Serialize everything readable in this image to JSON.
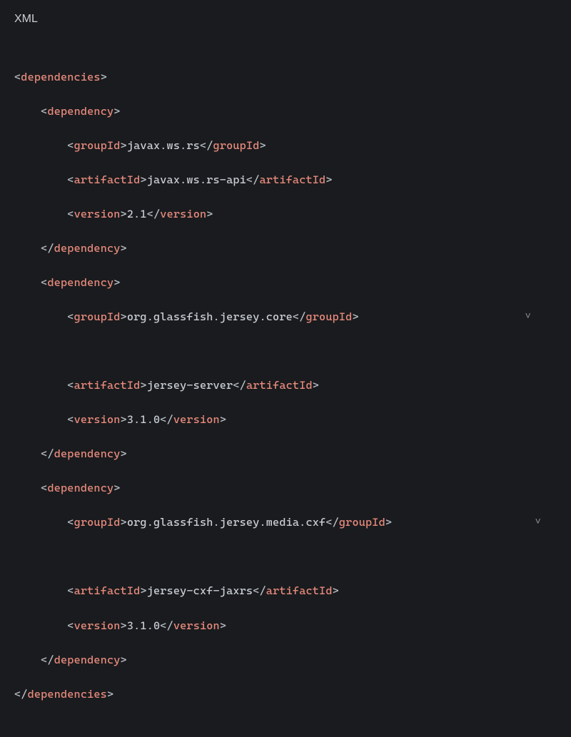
{
  "lang": "XML",
  "tags": {
    "dependencies": "dependencies",
    "dependency": "dependency",
    "groupId": "groupId",
    "artifactId": "artifactId",
    "version": "version"
  },
  "deps": [
    {
      "groupId": "javax.ws.rs",
      "artifactId": "javax.ws.rs-api",
      "version": "2.1"
    },
    {
      "groupId": "org.glassfish.jersey.core",
      "artifactId": "jersey-server",
      "version": "3.1.0"
    },
    {
      "groupId": "org.glassfish.jersey.media.cxf",
      "artifactId": "jersey-cxf-jaxrs",
      "version": "3.1.0"
    }
  ],
  "chevron": "˅"
}
